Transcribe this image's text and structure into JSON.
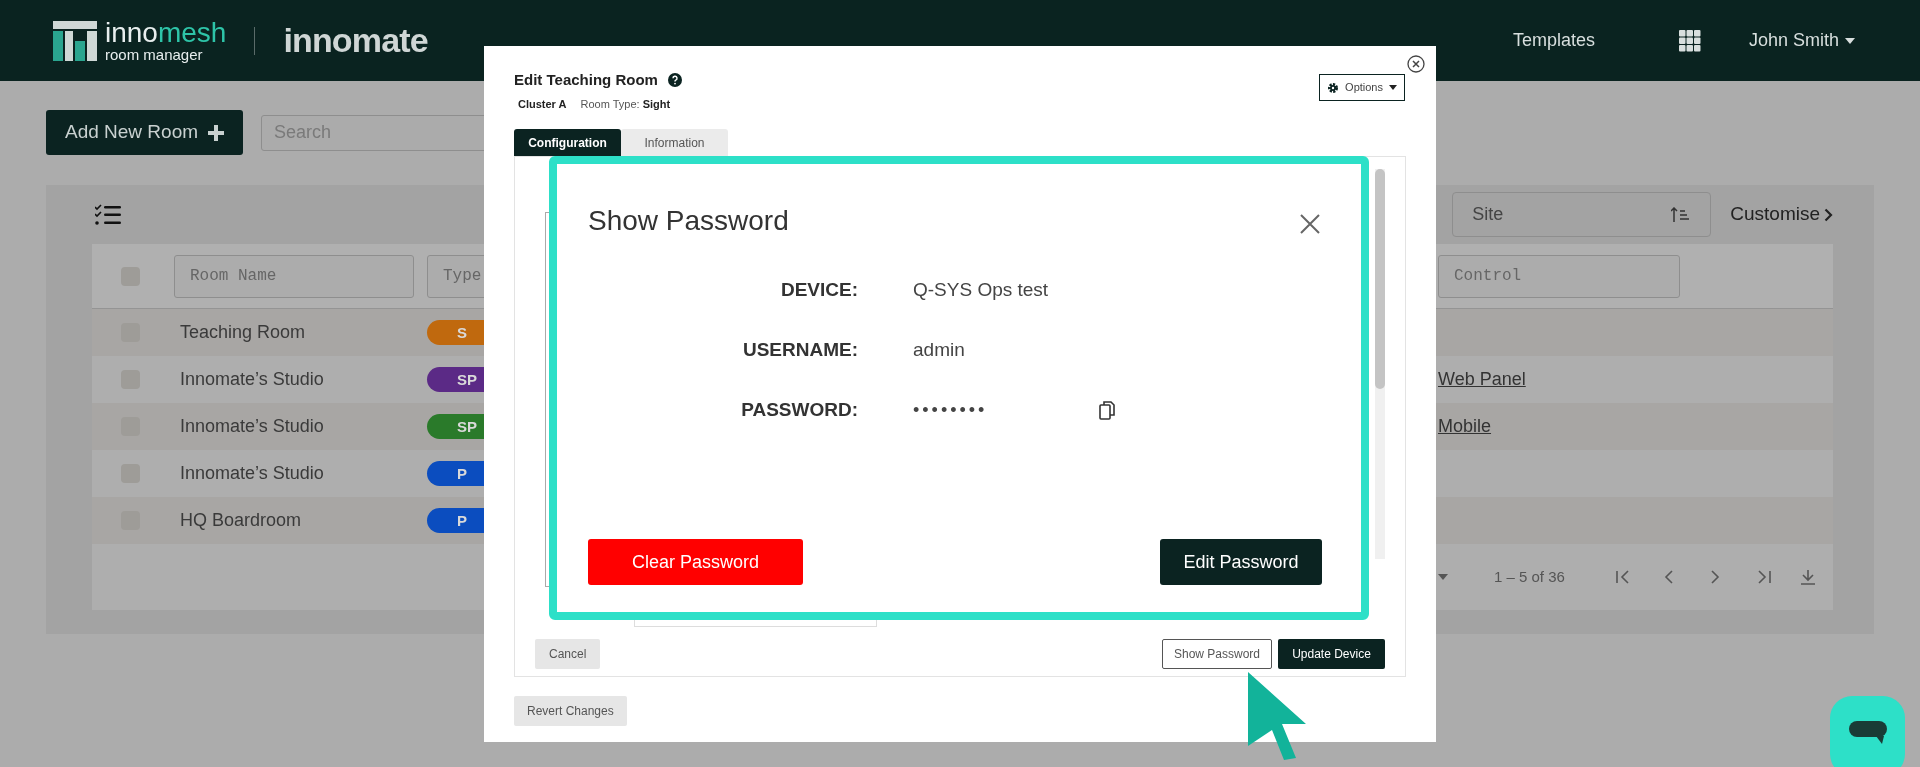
{
  "header": {
    "brand_a": "inno",
    "brand_b": "mesh",
    "brand_sub": "room manager",
    "partner": "innomate",
    "nav": [
      {
        "label": "Templates"
      }
    ],
    "user": "John Smith"
  },
  "toolbar": {
    "add_button": "Add New Room",
    "search": {
      "placeholder": "Search"
    },
    "site": {
      "placeholder": "Site"
    },
    "customise": "Customise"
  },
  "table": {
    "filters": [
      {
        "placeholder": "Room Name"
      },
      {
        "placeholder": "Type"
      },
      {
        "placeholder": "Control"
      }
    ],
    "header_checked": false,
    "rows": [
      {
        "checked": false,
        "name": "Teaching Room",
        "type": {
          "label": "S",
          "color": "#c0690e"
        }
      },
      {
        "checked": false,
        "name": "Innomate’s Studio",
        "type": {
          "label": "SP",
          "color": "#5b2a86"
        },
        "control": "Web Panel"
      },
      {
        "checked": false,
        "name": "Innomate’s Studio",
        "type": {
          "label": "SP",
          "color": "#2a7a2a"
        },
        "control": "Mobile"
      },
      {
        "checked": false,
        "name": "Innomate’s Studio",
        "type": {
          "label": "P",
          "color": "#0b4dbf"
        }
      },
      {
        "checked": false,
        "name": "HQ Boardroom",
        "type": {
          "label": "P",
          "color": "#0b4dbf"
        }
      }
    ],
    "pagination": "1 – 5 of 36"
  },
  "edit_dialog": {
    "title": "Edit Teaching Room",
    "cluster": "Cluster A",
    "room_type_label": "Room Type:",
    "room_type": "Sight",
    "options": "Options",
    "tabs": [
      {
        "label": "Configuration",
        "selected": true
      },
      {
        "label": "Information",
        "selected": false
      }
    ],
    "cancel": "Cancel",
    "show_password": "Show Password",
    "update": "Update Device",
    "revert": "Revert Changes"
  },
  "password_dialog": {
    "title": "Show Password",
    "fields": [
      {
        "kind": "text",
        "label": "DEVICE:",
        "value": "Q-SYS Ops test"
      },
      {
        "kind": "text",
        "label": "USERNAME:",
        "value": "admin"
      },
      {
        "kind": "secret",
        "label": "PASSWORD:",
        "value": "••••••••"
      }
    ],
    "clear": "Clear Password",
    "edit": "Edit Password"
  }
}
